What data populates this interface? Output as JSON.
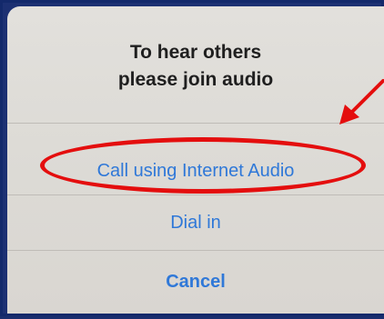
{
  "dialog": {
    "title_line1": "To hear others",
    "title_line2": "please join audio",
    "options": [
      {
        "label": "Call using Internet Audio"
      },
      {
        "label": "Dial in"
      },
      {
        "label": "Cancel"
      }
    ]
  },
  "annotation": {
    "color": "#e40e0e",
    "shape": "ellipse-with-arrow",
    "target": "Call using Internet Audio"
  },
  "colors": {
    "option_text": "#2f78d8",
    "title_text": "#1f1f1f",
    "sheet_bg": "#dddbd6",
    "frame": "#13296b"
  }
}
